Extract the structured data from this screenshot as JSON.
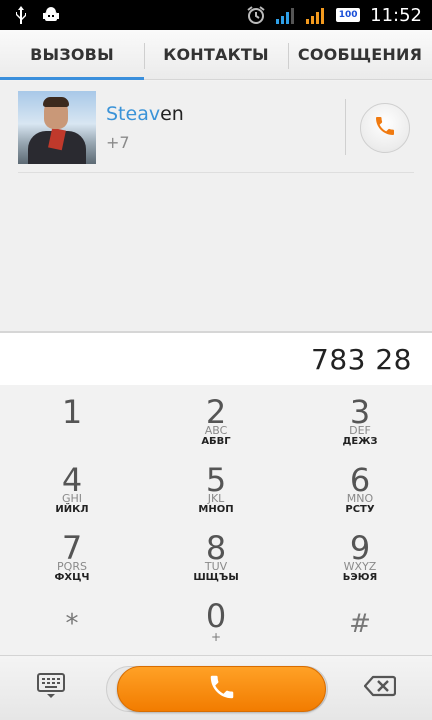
{
  "status_bar": {
    "icons": [
      "usb-icon",
      "android-debug-icon",
      "alarm-icon",
      "signal-icon",
      "signal-icon",
      "battery-icon"
    ],
    "battery_level": "100",
    "time": "11:52"
  },
  "tabs": [
    {
      "label": "ВЫЗОВЫ",
      "active": true
    },
    {
      "label": "КОНТАКТЫ",
      "active": false
    },
    {
      "label": "СООБЩЕНИЯ",
      "active": false
    }
  ],
  "contact": {
    "name_match": "Steav",
    "name_rest": "en",
    "number": "+7"
  },
  "dial": {
    "number": "783 28"
  },
  "keypad": {
    "keys": [
      {
        "digit": "1",
        "lat": "",
        "cyr": ""
      },
      {
        "digit": "2",
        "lat": "ABC",
        "cyr": "АБВГ"
      },
      {
        "digit": "3",
        "lat": "DEF",
        "cyr": "ДЕЖЗ"
      },
      {
        "digit": "4",
        "lat": "GHI",
        "cyr": "ИЙКЛ"
      },
      {
        "digit": "5",
        "lat": "JKL",
        "cyr": "МНОП"
      },
      {
        "digit": "6",
        "lat": "MNO",
        "cyr": "РСТУ"
      },
      {
        "digit": "7",
        "lat": "PQRS",
        "cyr": "ФХЦЧ"
      },
      {
        "digit": "8",
        "lat": "TUV",
        "cyr": "ШЩЪЫ"
      },
      {
        "digit": "9",
        "lat": "WXYZ",
        "cyr": "ЬЭЮЯ"
      },
      {
        "digit": "*",
        "lat": "",
        "cyr": ""
      },
      {
        "digit": "0",
        "lat": "+",
        "cyr": ""
      },
      {
        "digit": "#",
        "lat": "",
        "cyr": ""
      }
    ]
  },
  "colors": {
    "accent_blue": "#3a8fdc",
    "call_orange": "#f58a0e",
    "status_bar": "#000000"
  }
}
